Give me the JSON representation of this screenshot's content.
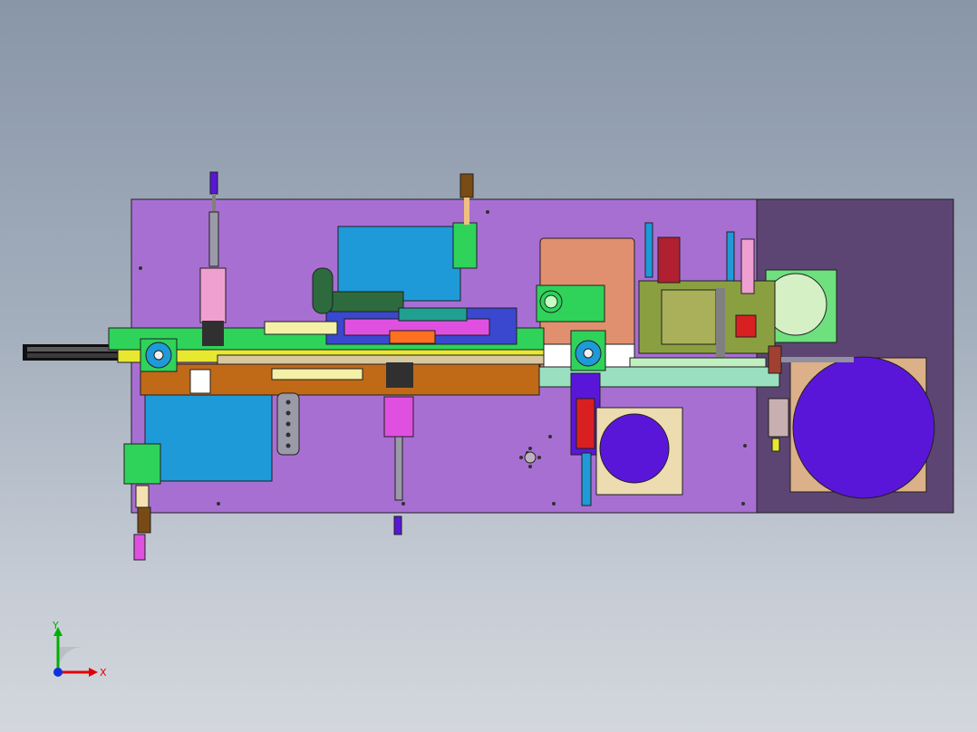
{
  "viewport": {
    "background_top": "#8996a8",
    "background_bottom": "#d3d7dd"
  },
  "triad": {
    "x_label": "X",
    "y_label": "Y",
    "x_color": "#e00000",
    "y_color": "#00b000",
    "origin_color": "#1030e0"
  },
  "colors": {
    "base_plate": "#a86fd3",
    "right_plate": "#5d4573",
    "outline": "#202020",
    "blue_block": "#1e9ad8",
    "salmon_block": "#e0906e",
    "tan_block": "#ecdcb0",
    "disc": "#5a16d8",
    "orange_rail": "#c06a18",
    "green_part": "#2fd35a",
    "bright_green": "#60ff40",
    "yellow_part": "#e8e830",
    "dark_green": "#2d6b3e",
    "magenta_cyl": "#e050e0",
    "grey_part": "#9a9aa8",
    "red_part": "#d82020",
    "light_green_part": "#c0f0c0"
  }
}
